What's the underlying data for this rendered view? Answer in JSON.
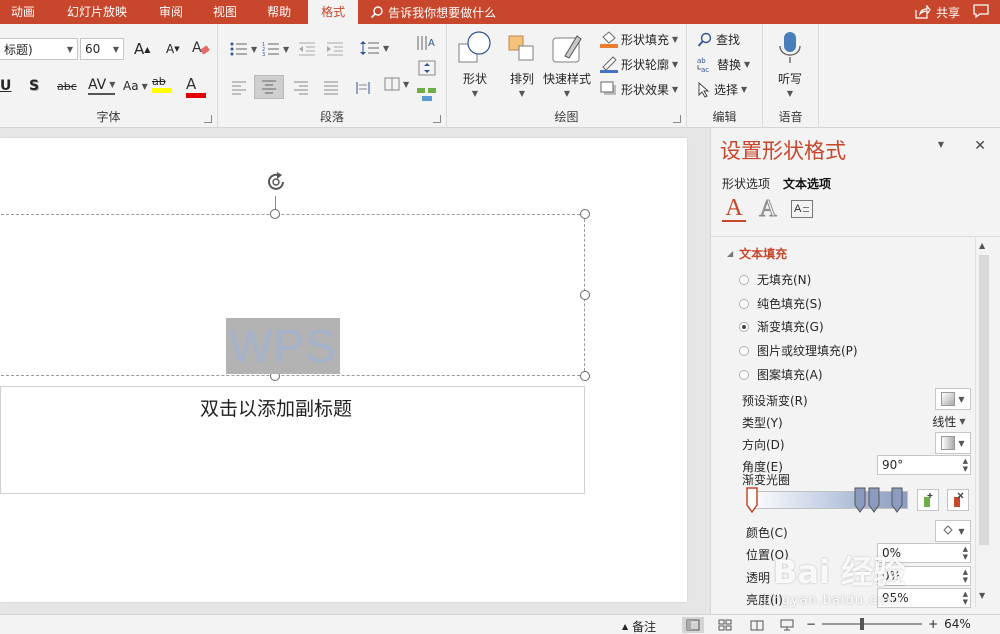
{
  "tabs": [
    "动画",
    "幻灯片放映",
    "审阅",
    "视图",
    "帮助",
    "格式"
  ],
  "active_tab": "格式",
  "tell_me": "告诉我你想要做什么",
  "share": "共享",
  "ribbon": {
    "font": {
      "name_value": "标题)",
      "size_value": "60",
      "label": "字体",
      "bold": "U",
      "shadow": "S",
      "strike": "abc",
      "spacing": "AV",
      "case": "Aa",
      "highlight": "ab",
      "grow": "A",
      "shrink": "A",
      "color_letter": "A"
    },
    "paragraph": {
      "label": "段落"
    },
    "drawing": {
      "label": "绘图",
      "shapes": "形状",
      "arrange": "排列",
      "quick_styles": "快速样式",
      "shape_fill": "形状填充",
      "shape_outline": "形状轮廓",
      "shape_effects": "形状效果"
    },
    "editing": {
      "label": "编辑",
      "find": "查找",
      "replace": "替换",
      "select": "选择"
    },
    "voice": {
      "label": "语音",
      "dictate": "听写"
    }
  },
  "slide": {
    "wps_text": "WPS",
    "subtitle_placeholder": "双击以添加副标题"
  },
  "pane": {
    "title": "设置形状格式",
    "tabs": [
      "形状选项",
      "文本选项"
    ],
    "active_tab": "文本选项",
    "icon_letters": [
      "A",
      "A",
      "A"
    ],
    "section_title": "文本填充",
    "fill_options": [
      {
        "label": "无填充(N)",
        "checked": false
      },
      {
        "label": "纯色填充(S)",
        "checked": false
      },
      {
        "label": "渐变填充(G)",
        "checked": true
      },
      {
        "label": "图片或纹理填充(P)",
        "checked": false
      },
      {
        "label": "图案填充(A)",
        "checked": false
      }
    ],
    "preset_label": "预设渐变(R)",
    "type_label": "类型(Y)",
    "type_value": "线性",
    "direction_label": "方向(D)",
    "angle_label": "角度(E)",
    "angle_value": "90°",
    "stops_label": "渐变光圈",
    "color_label": "颜色(C)",
    "position_label": "位置(O)",
    "position_value": "0%",
    "transparency_label": "透明",
    "transparency_value": "0%",
    "brightness_label": "亮度(I)",
    "brightness_value": "95%",
    "watermark": "Bai 经验",
    "watermark_url": "jingyan.baidu.com"
  },
  "status": {
    "notes": "备注",
    "zoom": "64%"
  },
  "colors": {
    "accent": "#c8462b",
    "ribbon_bg": "#f3f3f3",
    "wps_box": "#b3b3b3",
    "wps_text": "#a5b2cc"
  }
}
